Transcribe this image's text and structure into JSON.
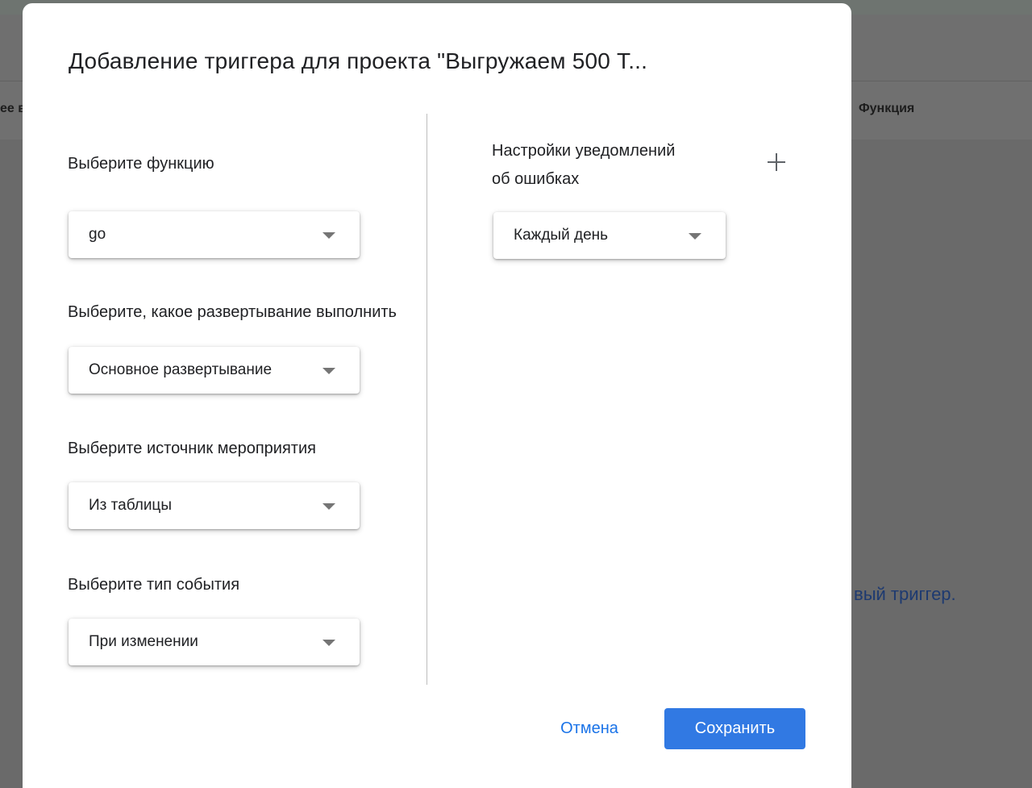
{
  "background": {
    "column_left_fragment": "ее в",
    "column_right": "Функция",
    "link_fragment": "вый триггер."
  },
  "dialog": {
    "title": "Добавление триггера для проекта \"Выгружаем 500 Т...",
    "function": {
      "label": "Выберите функцию",
      "value": "go"
    },
    "deployment": {
      "label": "Выберите, какое развертывание выполнить",
      "value": "Основное развертывание"
    },
    "event_source": {
      "label": "Выберите источник мероприятия",
      "value": "Из таблицы"
    },
    "event_type": {
      "label": "Выберите тип события",
      "value": "При изменении"
    },
    "notifications": {
      "label_line1": "Настройки уведомлений",
      "label_line2": "об ошибках",
      "value": "Каждый день",
      "add_icon": "plus-icon"
    },
    "buttons": {
      "cancel": "Отмена",
      "save": "Сохранить"
    }
  },
  "colors": {
    "primary_blue": "#1a73e8",
    "save_button_bg": "#3179e3",
    "overlay_gray": "#6b6b6b"
  }
}
